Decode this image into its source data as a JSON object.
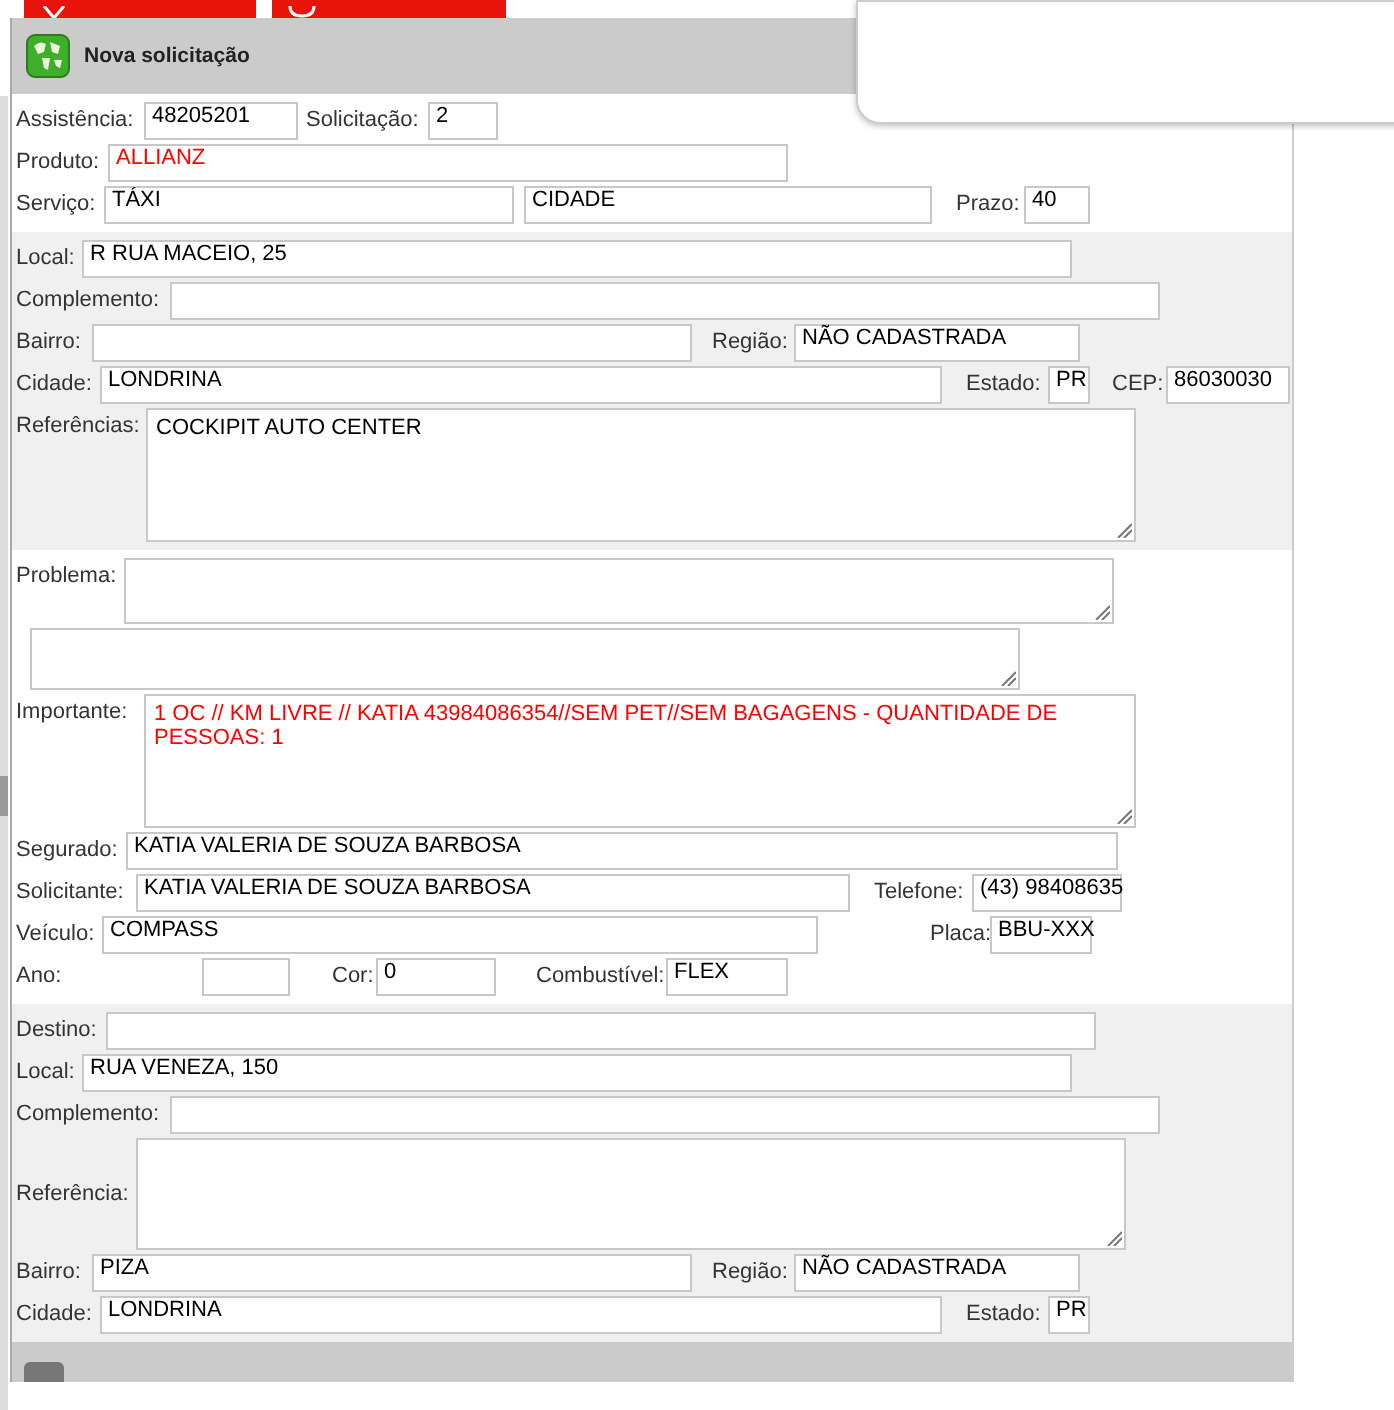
{
  "header": {
    "title": "Nova solicitação"
  },
  "sections": [
    {
      "kind": "plain",
      "rows": [
        {
          "fields": [
            {
              "label": "Assistência:",
              "value": "48205201",
              "kind": "text",
              "emphasis": false
            },
            {
              "label": "Solicitação:",
              "value": "2",
              "kind": "text",
              "emphasis": false
            }
          ]
        },
        {
          "fields": [
            {
              "label": "Produto:",
              "value": "ALLIANZ",
              "kind": "text",
              "emphasis": true
            }
          ]
        },
        {
          "fields": [
            {
              "label": "Serviço:",
              "value": "TÁXI",
              "kind": "text",
              "emphasis": false
            },
            {
              "value": "CIDADE",
              "kind": "text",
              "emphasis": false
            },
            {
              "label": "Prazo:",
              "value": "40",
              "kind": "text",
              "emphasis": false
            }
          ]
        }
      ]
    },
    {
      "kind": "shaded",
      "rows": [
        {
          "fields": [
            {
              "label": "Local:",
              "value": "R RUA MACEIO, 25",
              "kind": "text",
              "emphasis": false
            }
          ]
        },
        {
          "fields": [
            {
              "label": "Complemento:",
              "kind": "text"
            }
          ]
        },
        {
          "fields": [
            {
              "label": "Bairro:",
              "kind": "text"
            },
            {
              "label": "Região:",
              "value": "NÃO CADASTRADA",
              "kind": "text",
              "emphasis": false
            }
          ]
        },
        {
          "fields": [
            {
              "label": "Cidade:",
              "value": "LONDRINA",
              "kind": "text",
              "emphasis": false
            },
            {
              "label": "Estado:",
              "value": "PR",
              "kind": "text",
              "emphasis": false
            },
            {
              "label": "CEP:",
              "value": "86030030",
              "kind": "text",
              "emphasis": false
            }
          ]
        },
        {
          "fields": [
            {
              "label": "Referências:",
              "value": "COCKIPIT AUTO CENTER",
              "kind": "textarea",
              "emphasis": false
            }
          ]
        }
      ]
    },
    {
      "kind": "plain",
      "rows": [
        {
          "fields": [
            {
              "label": "Problema:",
              "kind": "textarea"
            }
          ]
        },
        {
          "fields": [
            {
              "kind": "textarea"
            }
          ]
        },
        {
          "fields": [
            {
              "label": "Importante:",
              "value": "1 OC // KM LIVRE // KATIA 43984086354//SEM PET//SEM BAGAGENS - QUANTIDADE DE PESSOAS: 1",
              "kind": "textarea",
              "emphasis": true
            }
          ]
        },
        {
          "fields": [
            {
              "label": "Segurado:",
              "value": "KATIA VALERIA DE SOUZA BARBOSA",
              "kind": "text",
              "emphasis": false
            }
          ]
        },
        {
          "fields": [
            {
              "label": "Solicitante:",
              "value": "KATIA VALERIA DE SOUZA BARBOSA",
              "kind": "text",
              "emphasis": false
            },
            {
              "label": "Telefone:",
              "value": "(43) 98408635",
              "kind": "text",
              "emphasis": false
            }
          ]
        },
        {
          "fields": [
            {
              "label": "Veículo:",
              "value": "COMPASS",
              "kind": "text",
              "emphasis": false
            },
            {
              "label": "Placa:",
              "value": "BBU-XXX",
              "kind": "text",
              "emphasis": false
            }
          ]
        },
        {
          "fields": [
            {
              "label": "Ano:",
              "kind": "text"
            },
            {
              "label": "Cor:",
              "value": "0",
              "kind": "text",
              "emphasis": false
            },
            {
              "label": "Combustível:",
              "value": "FLEX",
              "kind": "text",
              "emphasis": false
            }
          ]
        }
      ]
    },
    {
      "kind": "shaded",
      "rows": [
        {
          "fields": [
            {
              "label": "Destino:",
              "kind": "text"
            }
          ]
        },
        {
          "fields": [
            {
              "label": "Local:",
              "value": "RUA VENEZA, 150",
              "kind": "text",
              "emphasis": false
            }
          ]
        },
        {
          "fields": [
            {
              "label": "Complemento:",
              "kind": "text"
            }
          ]
        },
        {
          "fields": [
            {
              "label": "Referência:",
              "kind": "textarea"
            }
          ]
        },
        {
          "fields": [
            {
              "label": "Bairro:",
              "value": "PIZA",
              "kind": "text",
              "emphasis": false
            },
            {
              "label": "Região:",
              "value": "NÃO CADASTRADA",
              "kind": "text",
              "emphasis": false
            }
          ]
        },
        {
          "fields": [
            {
              "label": "Cidade:",
              "value": "LONDRINA",
              "kind": "text",
              "emphasis": false
            },
            {
              "label": "Estado:",
              "value": "PR",
              "kind": "text",
              "emphasis": false
            }
          ]
        }
      ]
    }
  ]
}
